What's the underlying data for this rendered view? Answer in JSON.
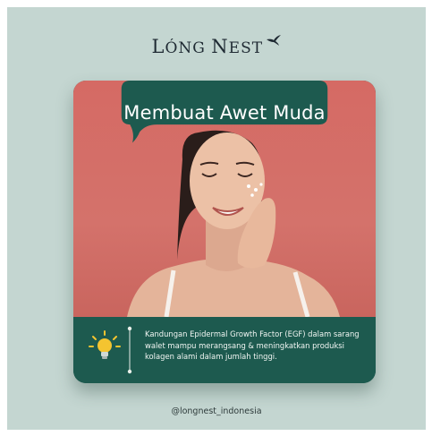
{
  "brand": {
    "logo_initial_1": "L",
    "logo_rest_1": "ÓNG",
    "logo_initial_2": "N",
    "logo_rest_2": "EST"
  },
  "card": {
    "title": "Membuat Awet Muda",
    "info_text": "Kandungan Epidermal Growth Factor (EGF) dalam sarang walet mampu merangsang & meningkatkan produksi kolagen alami dalam jumlah tinggi.",
    "bulb_icon": "lightbulb-icon"
  },
  "footer": {
    "handle": "@longnest_indonesia"
  },
  "colors": {
    "background": "#c4d6d1",
    "card_green": "#1d5a4f",
    "photo_backdrop": "#d56a64",
    "bulb_yellow": "#f4c430"
  }
}
